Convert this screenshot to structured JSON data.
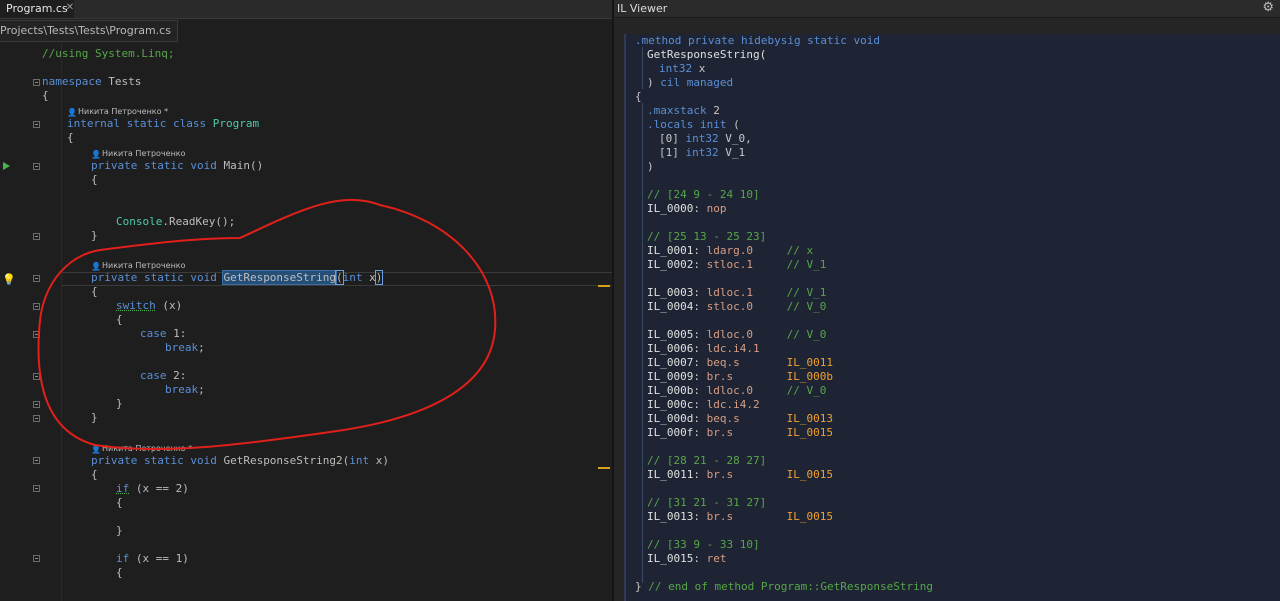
{
  "editor": {
    "tab_label": "Program.cs",
    "tab_close": "✕",
    "breadcrumb": "Projects\\Tests\\Tests\\Program.cs",
    "author_1": "Никита Петроченко *",
    "author_2": "Никита Петроченко",
    "author_3": "Никита Петроченко",
    "author_4": "Никита Петроченко *",
    "code": {
      "l_using": "//using System.Linq;",
      "l_namespace_kw": "namespace",
      "l_namespace_name": " Tests",
      "brace_open": "{",
      "brace_close": "}",
      "l_class_kw": "internal static class ",
      "l_class_name": "Program",
      "l_main_kw": "private static void ",
      "l_main_name": "Main()",
      "l_readkey_type": "Console",
      "l_readkey_rest": ".ReadKey();",
      "l_grs_kw": "private static void ",
      "l_grs_name": "GetResponseString",
      "l_grs_open": "(",
      "l_grs_param_kw": "int",
      "l_grs_param": " x",
      "l_grs_close": ")",
      "l_switch_kw": "switch",
      "l_switch_rest": " (x)",
      "l_case1_kw": "case",
      "l_case1_rest": " 1:",
      "l_break": "break",
      "l_semicolon": ";",
      "l_case2_kw": "case",
      "l_case2_rest": " 2:",
      "l_grs2_kw": "private static void ",
      "l_grs2_name": "GetResponseString2(",
      "l_grs2_param_kw": "int",
      "l_grs2_param": " x)",
      "l_if_kw": "if",
      "l_if1_rest": " (x == 2)",
      "l_if2_rest": " (x == 1)"
    }
  },
  "il_viewer": {
    "title": "IL Viewer",
    "settings_icon": "gear-icon",
    "lines": {
      "m1": ".method private hidebysig static void",
      "m2": "GetResponseString(",
      "m3_kw": "int32",
      "m3_rest": " x",
      "m4_paren": ") ",
      "m4_kw": "cil managed",
      "m5": "{",
      "maxstack_kw": ".maxstack",
      "maxstack_val": " 2",
      "locals_kw": ".locals init",
      "locals_paren": " (",
      "loc0_idx": "[0] ",
      "loc0_kw": "int32",
      "loc0_name": " V_0,",
      "loc1_idx": "[1] ",
      "loc1_kw": "int32",
      "loc1_name": " V_1",
      "locals_close": ")",
      "c1": "// [24 9 - 24 10]",
      "il0000": "IL_0000",
      "op0000": "nop",
      "c2": "// [25 13 - 25 23]",
      "il0001": "IL_0001",
      "op0001": "ldarg.0",
      "cm0001": "// x",
      "il0002": "IL_0002",
      "op0002": "stloc.1",
      "cm0002": "// V_1",
      "il0003": "IL_0003",
      "op0003": "ldloc.1",
      "cm0003": "// V_1",
      "il0004": "IL_0004",
      "op0004": "stloc.0",
      "cm0004": "// V_0",
      "il0005": "IL_0005",
      "op0005": "ldloc.0",
      "cm0005": "// V_0",
      "il0006": "IL_0006",
      "op0006": "ldc.i4.1",
      "il0007": "IL_0007",
      "op0007": "beq.s",
      "tg0007": "IL_0011",
      "il0009": "IL_0009",
      "op0009": "br.s",
      "tg0009": "IL_000b",
      "il000b": "IL_000b",
      "op000b": "ldloc.0",
      "cm000b": "// V_0",
      "il000c": "IL_000c",
      "op000c": "ldc.i4.2",
      "il000d": "IL_000d",
      "op000d": "beq.s",
      "tg000d": "IL_0013",
      "il000f": "IL_000f",
      "op000f": "br.s",
      "tg000f": "IL_0015",
      "c3": "// [28 21 - 28 27]",
      "il0011": "IL_0011",
      "op0011": "br.s",
      "tg0011": "IL_0015",
      "c4": "// [31 21 - 31 27]",
      "il0013": "IL_0013",
      "op0013": "br.s",
      "tg0013": "IL_0015",
      "c5": "// [33 9 - 33 10]",
      "il0015": "IL_0015",
      "op0015": "ret",
      "end_brace": "}",
      "end_comment": " // end of method Program::GetResponseString"
    }
  },
  "colors": {
    "keyword": "#5a8fd6",
    "comment": "#57a64a",
    "type": "#4ec9b0",
    "il_opcode": "#d69d85",
    "il_target": "#f0a030",
    "annotation": "#e0201a"
  }
}
